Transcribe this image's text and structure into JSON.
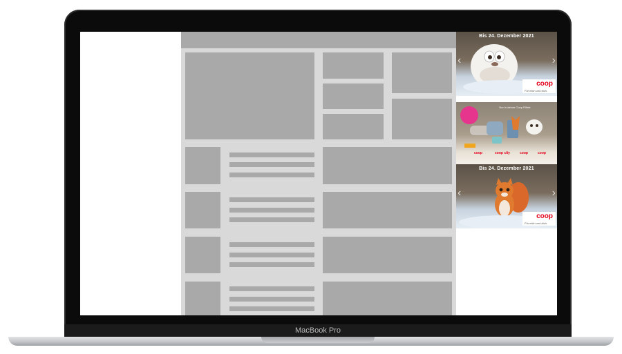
{
  "device": {
    "model_label": "MacBook Pro"
  },
  "ads": [
    {
      "headline": "Bis 24. Dezember 2021",
      "brand": "coop",
      "tagline": "Für mich und dich."
    },
    {
      "headline": "",
      "small_headline": "Nur in deiner Coop Filiale",
      "badge": "",
      "brands": [
        "coop",
        "coop city",
        "coop",
        "coop"
      ]
    },
    {
      "headline": "Bis 24. Dezember 2021",
      "brand": "coop",
      "tagline": "Für mich und dich."
    }
  ],
  "colors": {
    "coop_red": "#e2001a",
    "wire_block": "#a9a9a9",
    "wire_bg": "#d9d9d9",
    "bezel": "#0b0b0b"
  },
  "icons": {
    "carousel_prev": "chevron-left-icon",
    "carousel_next": "chevron-right-icon"
  }
}
